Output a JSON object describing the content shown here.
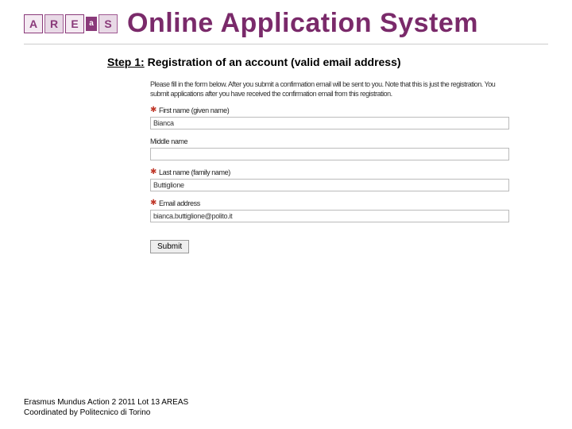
{
  "header": {
    "logo_letters": [
      "A",
      "R",
      "E",
      "a",
      "S"
    ],
    "title": "Online Application System"
  },
  "step": {
    "label": "Step 1:",
    "text": "Registration of an account (valid email address)"
  },
  "form": {
    "intro": "Please fill in the form below. After you submit a confirmation email will be sent to you. Note that this is just the registration. You submit applications after you have received the confirmation email from this registration.",
    "fields": {
      "first_name": {
        "label": "First name (given name)",
        "value": "Bianca",
        "required": true
      },
      "middle_name": {
        "label": "Middle name",
        "value": "",
        "required": false
      },
      "last_name": {
        "label": "Last name (family name)",
        "value": "Buttiglione",
        "required": true
      },
      "email": {
        "label": "Email address",
        "value": "bianca.buttiglione@polito.it",
        "required": true
      }
    },
    "submit_label": "Submit"
  },
  "footer": {
    "line1": "Erasmus Mundus Action 2 2011 Lot 13 AREAS",
    "line2": "Coordinated by Politecnico di Torino"
  },
  "icons": {
    "required_glyph": "✱"
  }
}
